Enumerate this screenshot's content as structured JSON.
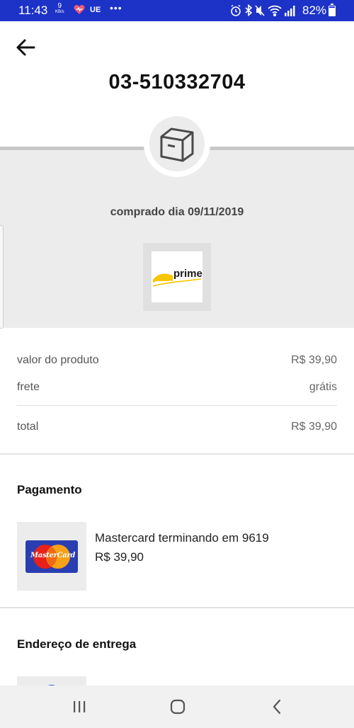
{
  "status_bar": {
    "time": "11:43",
    "speed_value": "9",
    "speed_unit": "KB/s",
    "carrier_badge": "UE",
    "more_dots": "•••",
    "battery_percent": "82%",
    "battery_level": 0.82,
    "icons": [
      "heart-icon",
      "alarm-icon",
      "bluetooth-icon",
      "mute-icon",
      "wifi-icon",
      "signal-icon",
      "battery-icon"
    ]
  },
  "header": {
    "back_icon": "arrow-left-icon",
    "order_id": "03-510332704"
  },
  "order": {
    "status_icon": "package-box-icon",
    "purchase_date": "comprado dia 09/11/2019",
    "product_image_text": "prime"
  },
  "summary": {
    "product_value_label": "valor do produto",
    "product_value": "R$ 39,90",
    "shipping_label": "frete",
    "shipping_value": "grátis",
    "total_label": "total",
    "total_value": "R$ 39,90"
  },
  "payment": {
    "title": "Pagamento",
    "card_brand_text": "MasterCard",
    "card_description": "Mastercard terminando em 9619",
    "amount": "R$ 39,90"
  },
  "delivery": {
    "title": "Endereço de entrega"
  },
  "nav": {
    "icons": [
      "recent-apps-icon",
      "home-icon",
      "back-icon"
    ]
  },
  "colors": {
    "status_bar": "#1d33c7",
    "band": "#ececec",
    "prime_yellow": "#f7c600",
    "mastercard_blue": "#2a3eb1",
    "mastercard_red": "#e8211b",
    "mastercard_orange": "#f6a11a"
  }
}
